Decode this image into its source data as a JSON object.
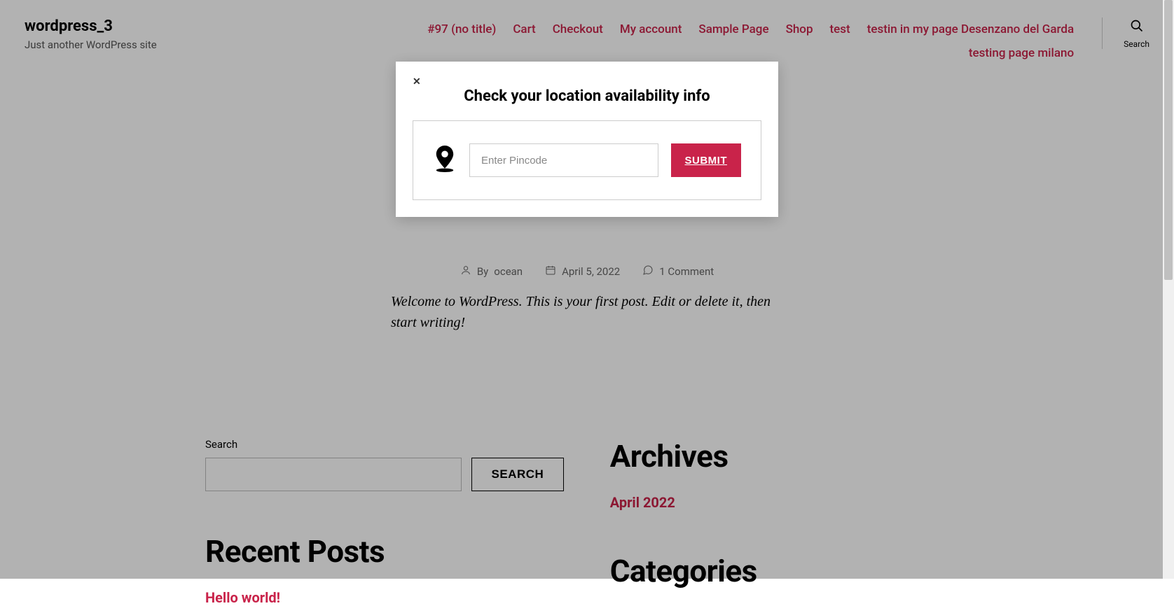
{
  "site": {
    "title": "wordpress_3",
    "tagline": "Just another WordPress site"
  },
  "nav": {
    "items": [
      "#97 (no title)",
      "Cart",
      "Checkout",
      "My account",
      "Sample Page",
      "Shop",
      "test",
      "testin in my page Desenzano del Garda",
      "testing page milano"
    ],
    "search_label": "Search"
  },
  "post": {
    "by_label": "By",
    "author": "ocean",
    "date": "April 5, 2022",
    "comments": "1 Comment",
    "content": "Welcome to WordPress. This is your first post. Edit or delete it, then start writing!"
  },
  "widgets": {
    "search": {
      "label": "Search",
      "button": "SEARCH"
    },
    "recent_posts": {
      "heading": "Recent Posts",
      "items": [
        "Hello world!"
      ]
    },
    "archives": {
      "heading": "Archives",
      "items": [
        "April 2022"
      ]
    },
    "categories": {
      "heading": "Categories"
    }
  },
  "modal": {
    "title": "Check your location availability info",
    "placeholder": "Enter Pincode",
    "submit": "SUBMIT"
  }
}
